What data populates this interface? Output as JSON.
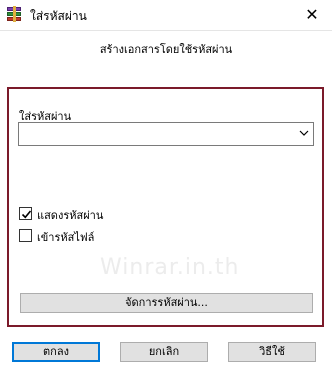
{
  "window": {
    "title": "ใส่รหัสผ่าน",
    "close_glyph": "✕"
  },
  "heading": "สร้างเอกสารโดยใช้รหัสผ่าน",
  "password_field": {
    "label": "ใส่รหัสผ่าน",
    "value": ""
  },
  "options": [
    {
      "label": "แสดงรหัสผ่าน",
      "checked": true
    },
    {
      "label": "เข้ารหัสไฟล์",
      "checked": false
    }
  ],
  "watermark": "Winrar.in.th",
  "buttons": {
    "organize": "จัดการรหัสผ่าน...",
    "ok": "ตกลง",
    "cancel": "ยกเลิก",
    "help": "วิธีใช้"
  },
  "colors": {
    "group_border": "#7b1a2a",
    "default_button_border": "#0078d7"
  },
  "icons": {
    "app": "winrar-books-icon",
    "close": "close-icon",
    "dropdown": "chevron-down-icon",
    "check": "checkmark-icon"
  }
}
